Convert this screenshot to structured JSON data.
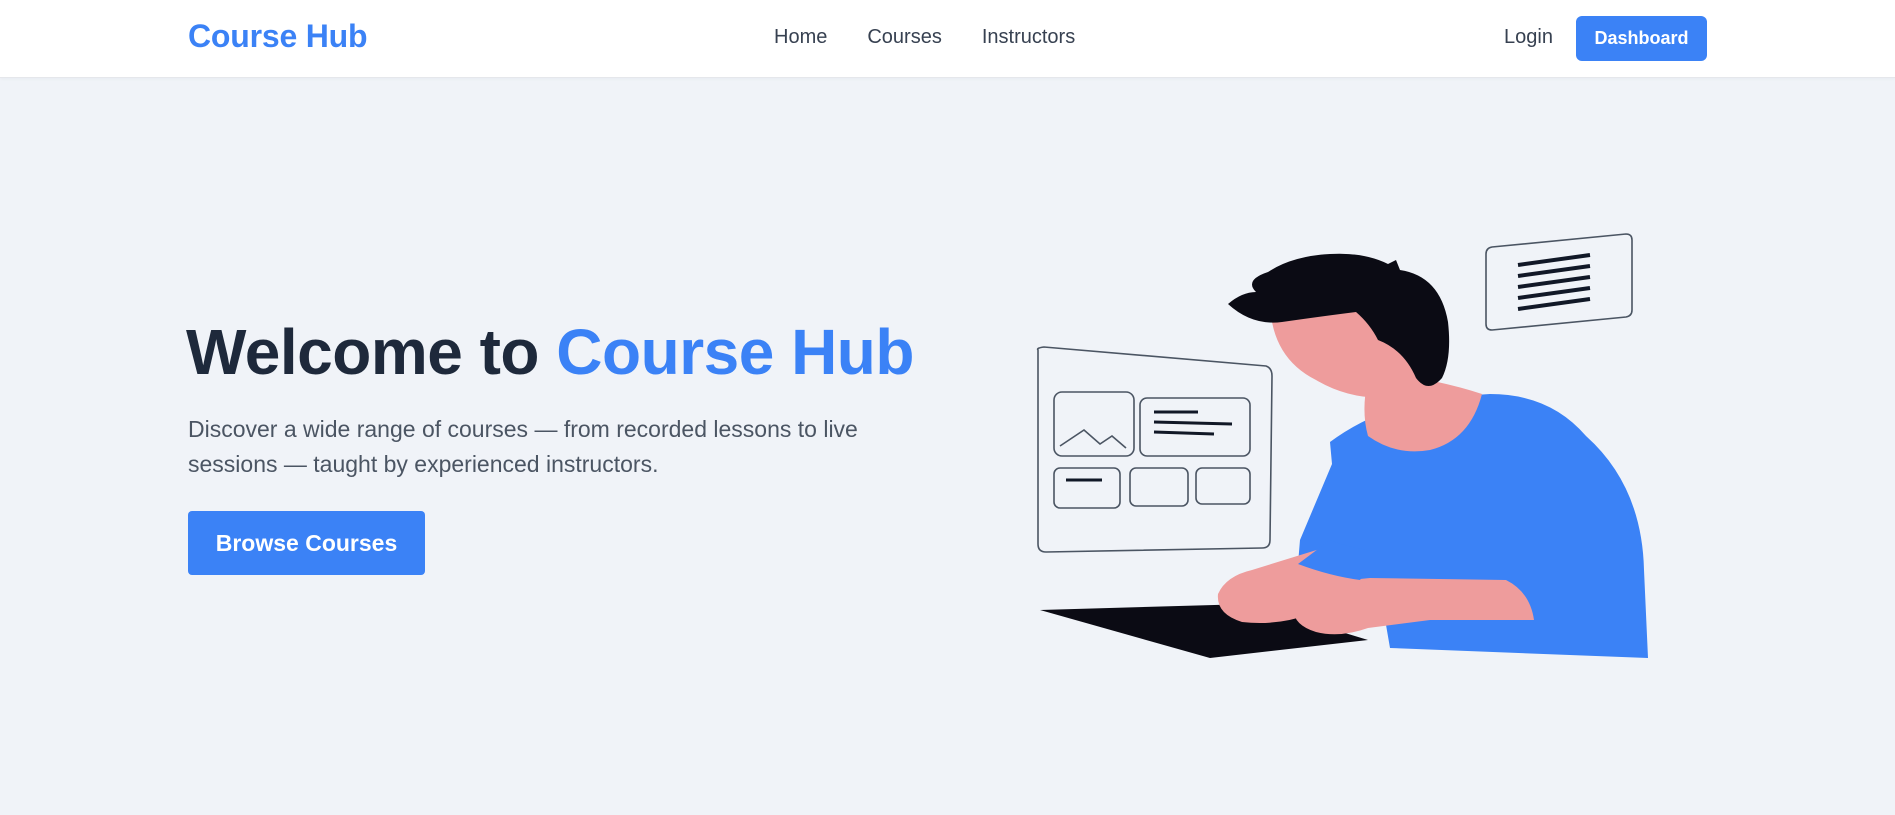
{
  "header": {
    "brand": "Course Hub",
    "nav": [
      {
        "label": "Home"
      },
      {
        "label": "Courses"
      },
      {
        "label": "Instructors"
      }
    ],
    "login_label": "Login",
    "dashboard_label": "Dashboard"
  },
  "hero": {
    "title_prefix": "Welcome to ",
    "title_accent": "Course Hub",
    "description": "Discover a wide range of courses — from recorded lessons to live sessions — taught by experienced instructors.",
    "cta_label": "Browse Courses"
  },
  "colors": {
    "accent": "#3b82f6",
    "heading": "#1e293b",
    "background": "#f0f3f8"
  }
}
